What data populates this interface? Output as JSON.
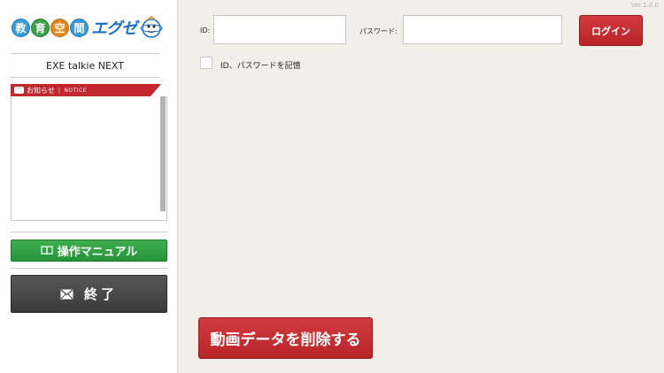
{
  "sidebar": {
    "logo": {
      "kanji": [
        "教",
        "育",
        "空",
        "間"
      ],
      "katakana": "エグゼ",
      "mascot_icon": "mascot-icon"
    },
    "app_name": "EXE talkie NEXT",
    "notice": {
      "title": "お知らせ",
      "subtitle": "NOTICE",
      "icon": "speech-bubble-icon"
    },
    "manual_button": {
      "label": "操作マニュアル",
      "icon": "book-icon"
    },
    "exit_button": {
      "label": "終了",
      "icon": "mail-icon"
    }
  },
  "version": "Ver.1.0.0",
  "login": {
    "id_label": "ID:",
    "id_value": "",
    "password_label": "パスワード:",
    "password_value": "",
    "button_label": "ログイン",
    "remember_label": "ID、パスワードを記憶",
    "remember_checked": false
  },
  "delete_button": {
    "label": "動画データを削除する"
  },
  "colors": {
    "accent_red": "#c1272d",
    "manual_green": "#2ea043",
    "exit_dark": "#454545",
    "background": "#f1efe7"
  }
}
